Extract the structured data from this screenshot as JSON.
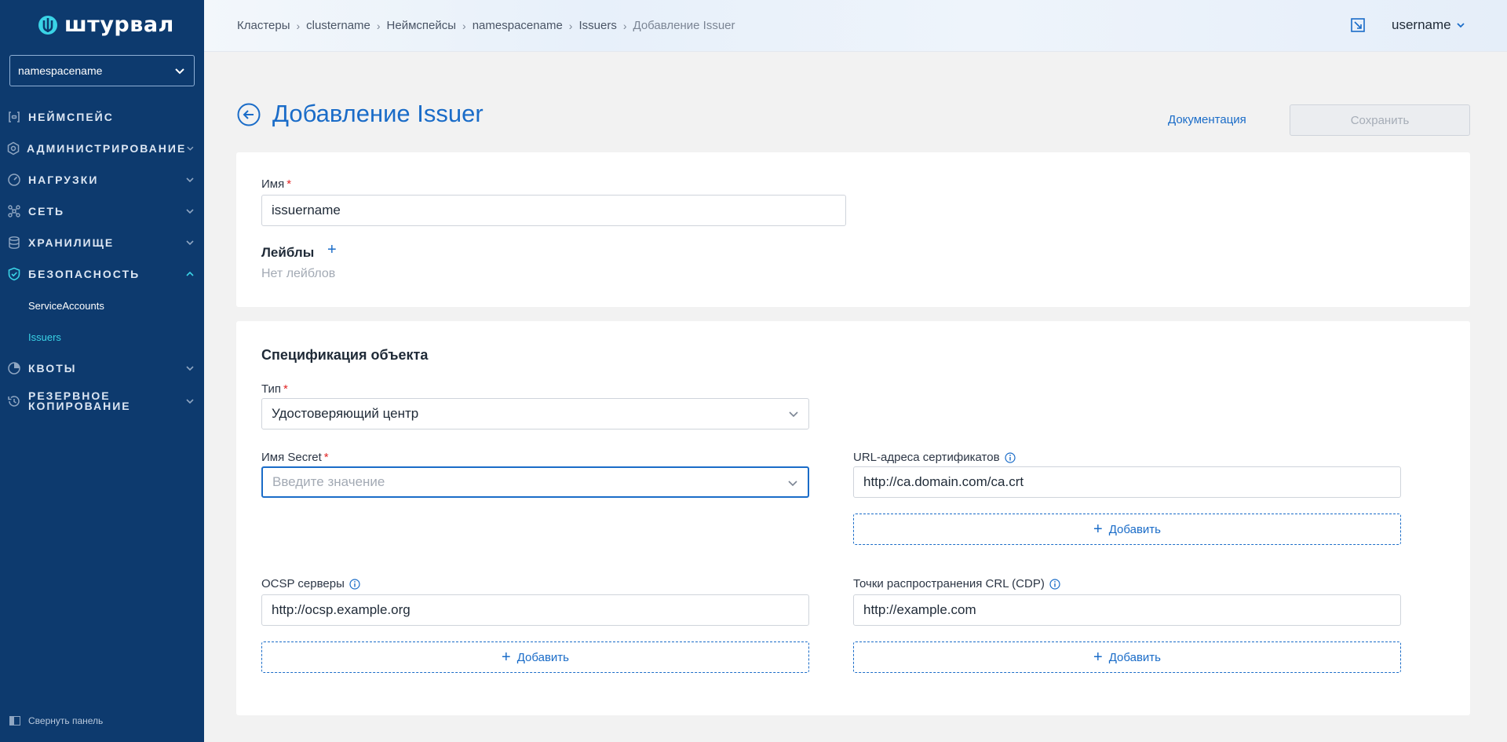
{
  "sidebar": {
    "logo_text": "штурвал",
    "namespace_select": "namespacename",
    "items": [
      {
        "label": "Неймспейс",
        "icon": "namespace-icon"
      },
      {
        "label": "Администрирование",
        "icon": "gear-icon"
      },
      {
        "label": "Нагрузки",
        "icon": "gauge-icon"
      },
      {
        "label": "Сеть",
        "icon": "network-icon"
      },
      {
        "label": "Хранилище",
        "icon": "database-icon"
      },
      {
        "label": "Безопасность",
        "icon": "shield-icon"
      },
      {
        "label": "Квоты",
        "icon": "pie-icon"
      },
      {
        "label": "Резервное копирование",
        "icon": "backup-icon"
      }
    ],
    "sub_items": [
      "ServiceAccounts",
      "Issuers"
    ],
    "collapse_label": "Свернуть панель"
  },
  "header": {
    "breadcrumbs": [
      "Кластеры",
      "clustername",
      "Неймспейсы",
      "namespacename",
      "Issuers",
      "Добавление Issuer"
    ],
    "user": "username"
  },
  "page": {
    "title": "Добавление Issuer",
    "docs_link": "Документация",
    "save_button": "Сохранить"
  },
  "form": {
    "name_label": "Имя",
    "name_value": "issuername",
    "labels_title": "Лейблы",
    "labels_empty": "Нет лейблов",
    "spec_title": "Спецификация объекта",
    "type_label": "Тип",
    "type_value": "Удостоверяющий центр",
    "secret_label": "Имя Secret",
    "secret_placeholder": "Введите значение",
    "cert_urls_label": "URL-адреса сертификатов",
    "cert_urls_value": "http://ca.domain.com/ca.crt",
    "ocsp_label": "OCSP серверы",
    "ocsp_value": "http://ocsp.example.org",
    "crl_label": "Точки распространения CRL (CDP)",
    "crl_value": "http://example.com",
    "add_label": "Добавить"
  },
  "colors": {
    "sidebar_bg": "#0d3a6e",
    "accent": "#1a6cc8",
    "active_sub": "#3ad3e6",
    "required": "#e02424"
  }
}
